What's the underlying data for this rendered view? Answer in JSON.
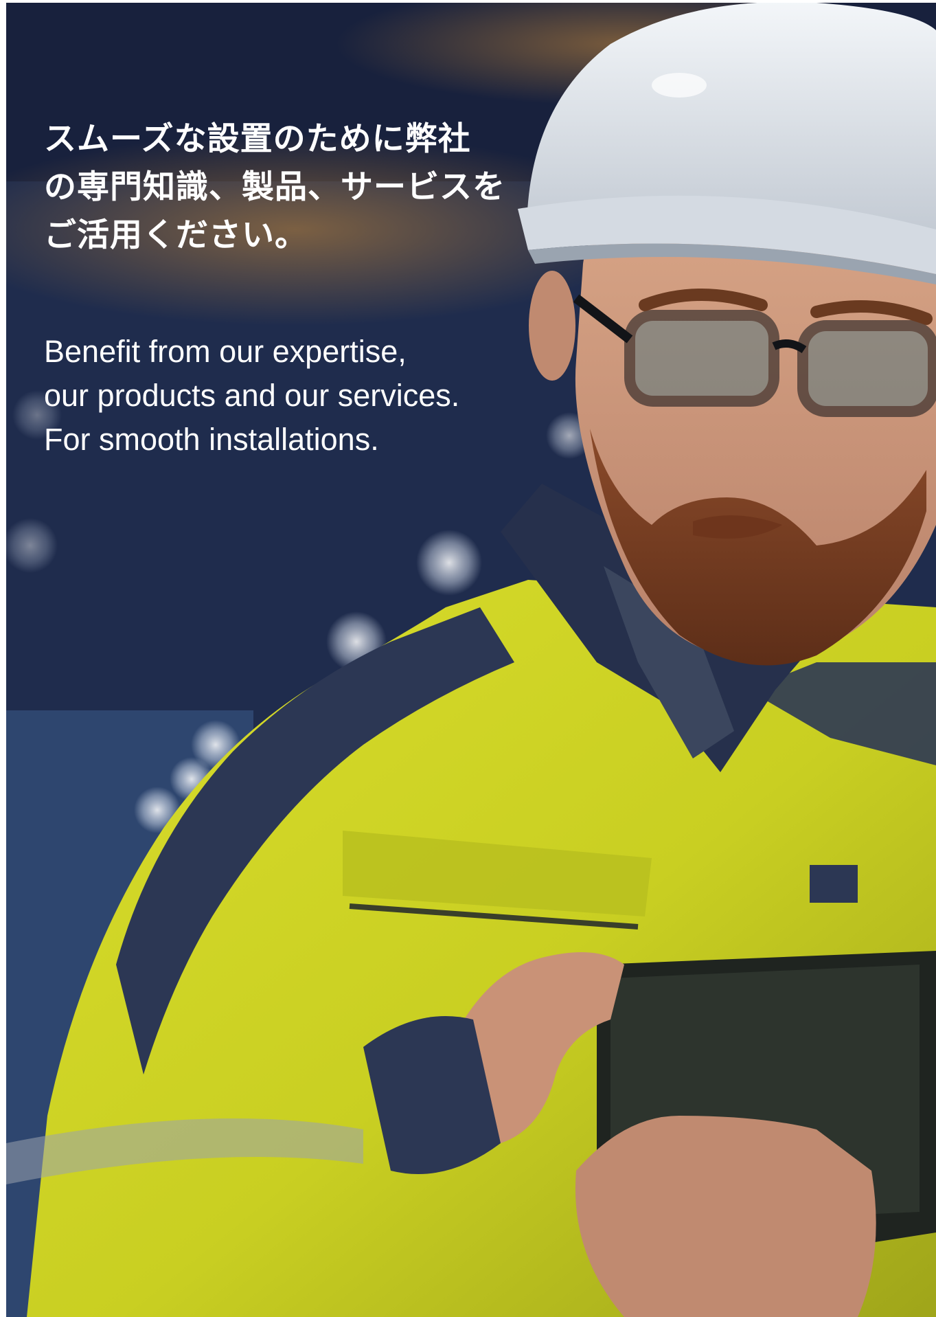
{
  "heading_jp": {
    "lines": [
      "スムーズな設置のために弊社",
      "の専門知識、製品、サービスを",
      "ご活用ください。"
    ]
  },
  "heading_en": {
    "lines": [
      "Benefit from our expertise,",
      "our products and our services.",
      "For smooth installations."
    ]
  },
  "photo": {
    "subject": "engineer-with-tablet-photo"
  },
  "colors": {
    "text": "#ffffff",
    "background_navy": "#25355e",
    "jacket_yellow": "#d8dc2a",
    "jacket_navy": "#2c3754",
    "helmet_white": "#e9edf2"
  }
}
